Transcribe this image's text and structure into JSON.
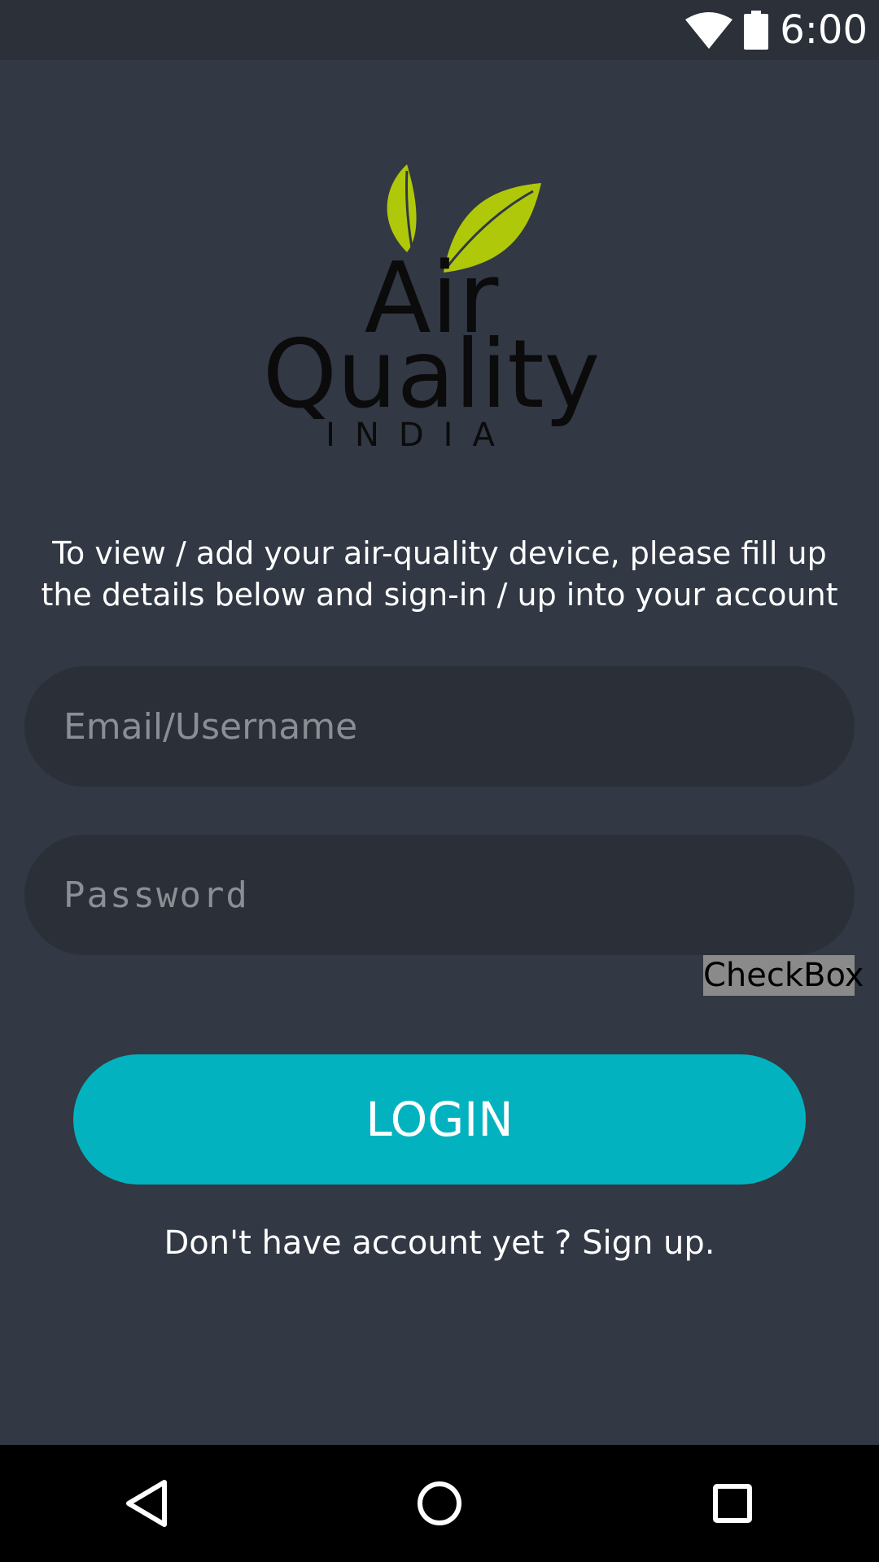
{
  "status_bar": {
    "time": "6:00",
    "icons": [
      "wifi-icon",
      "battery-icon"
    ]
  },
  "logo": {
    "line1": "Air",
    "line2": "Quality",
    "line3": "INDIA",
    "leaf_color": "#b0c80a"
  },
  "intro": {
    "text": "To view / add your air-quality device, please fill up the details below and sign-in / up into your account"
  },
  "form": {
    "email_placeholder": "Email/Username",
    "password_placeholder": "Password",
    "checkbox_label": "CheckBox",
    "login_label": "LOGIN"
  },
  "signup": {
    "text": "Don't have account yet ? Sign up."
  },
  "nav_bar": {
    "icons": [
      "back-icon",
      "home-icon",
      "recents-icon"
    ]
  },
  "colors": {
    "background": "#323844",
    "field": "#2b3038",
    "accent": "#02b3bf"
  }
}
